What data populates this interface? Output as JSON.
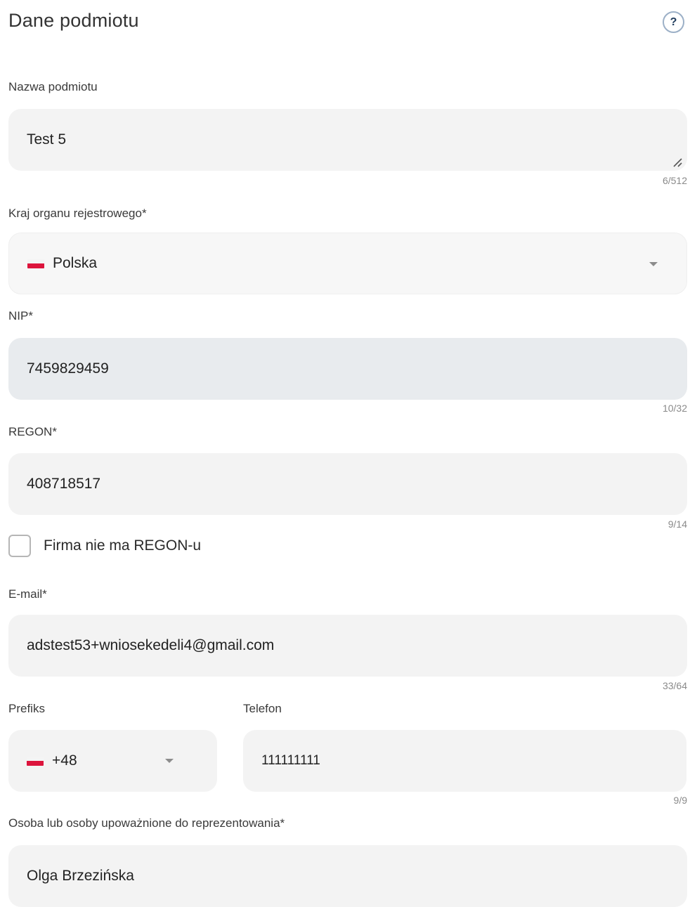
{
  "header": {
    "title": "Dane podmiotu",
    "help_glyph": "?"
  },
  "entity_name": {
    "label": "Nazwa podmiotu",
    "value": "Test 5",
    "counter": "6/512"
  },
  "country": {
    "label": "Kraj organu rejestrowego*",
    "value": "Polska",
    "flag_icon": "poland-flag-icon"
  },
  "nip": {
    "label": "NIP*",
    "value": "7459829459",
    "counter": "10/32"
  },
  "regon": {
    "label": "REGON*",
    "value": "408718517",
    "counter": "9/14"
  },
  "no_regon": {
    "label": "Firma nie ma REGON-u",
    "checked": false
  },
  "email": {
    "label": "E-mail*",
    "value": "adstest53+wniosekedeli4@gmail.com",
    "counter": "33/64"
  },
  "prefix": {
    "label": "Prefiks",
    "value": "+48",
    "flag_icon": "poland-flag-icon"
  },
  "phone": {
    "label": "Telefon",
    "value": "111111111",
    "counter": "9/9"
  },
  "representatives": {
    "label": "Osoba lub osoby upoważnione do reprezentowania*",
    "value": "Olga Brzezińska"
  },
  "colors": {
    "field_bg": "#f3f3f3",
    "disabled_bg": "#e8ebee",
    "help_border": "#9cb0c7",
    "flag_red": "#dc143c"
  }
}
